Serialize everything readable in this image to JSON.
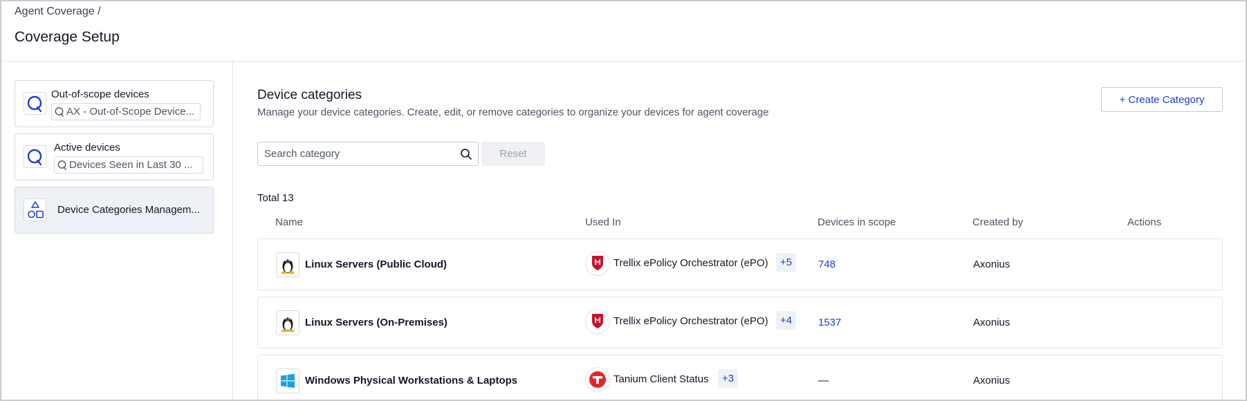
{
  "header": {
    "breadcrumb": "Agent Coverage /",
    "title": "Coverage Setup"
  },
  "sidebar": {
    "cards": [
      {
        "title": "Out-of-scope devices",
        "query": "AX - Out-of-Scope Device..."
      },
      {
        "title": "Active devices",
        "query": "Devices Seen in Last 30 ..."
      },
      {
        "title": "Device Categories Managem..."
      }
    ]
  },
  "main": {
    "title": "Device categories",
    "description": "Manage your device categories. Create, edit, or remove categories to organize your devices for agent coverage",
    "create_label": "+ Create Category",
    "search_placeholder": "Search category",
    "reset_label": "Reset",
    "total": "Total 13",
    "columns": [
      "Name",
      "Used In",
      "Devices in scope",
      "Created by",
      "Actions"
    ],
    "rows": [
      {
        "os_icon": "linux-icon",
        "name": "Linux Servers (Public Cloud)",
        "adapter_icon": "trellix-epo-icon",
        "adapter": "Trellix ePolicy Orchestrator (ePO)",
        "extra": "+5",
        "devices": "748",
        "created_by": "Axonius"
      },
      {
        "os_icon": "linux-icon",
        "name": "Linux Servers (On-Premises)",
        "adapter_icon": "trellix-epo-icon",
        "adapter": "Trellix ePolicy Orchestrator (ePO)",
        "extra": "+4",
        "devices": "1537",
        "created_by": "Axonius"
      },
      {
        "os_icon": "windows-icon",
        "name": "Windows Physical Workstations & Laptops",
        "adapter_icon": "tanium-icon",
        "adapter": "Tanium Client Status",
        "extra": "+3",
        "devices": "—",
        "created_by": "Axonius"
      }
    ]
  },
  "colors": {
    "accent": "#1d3ed6",
    "border": "#dfe2e6",
    "active_card_bg": "#eef1f6",
    "trellix_red": "#c8102e",
    "tanium_red": "#e3262d",
    "windows_blue": "#1ba1e2"
  }
}
